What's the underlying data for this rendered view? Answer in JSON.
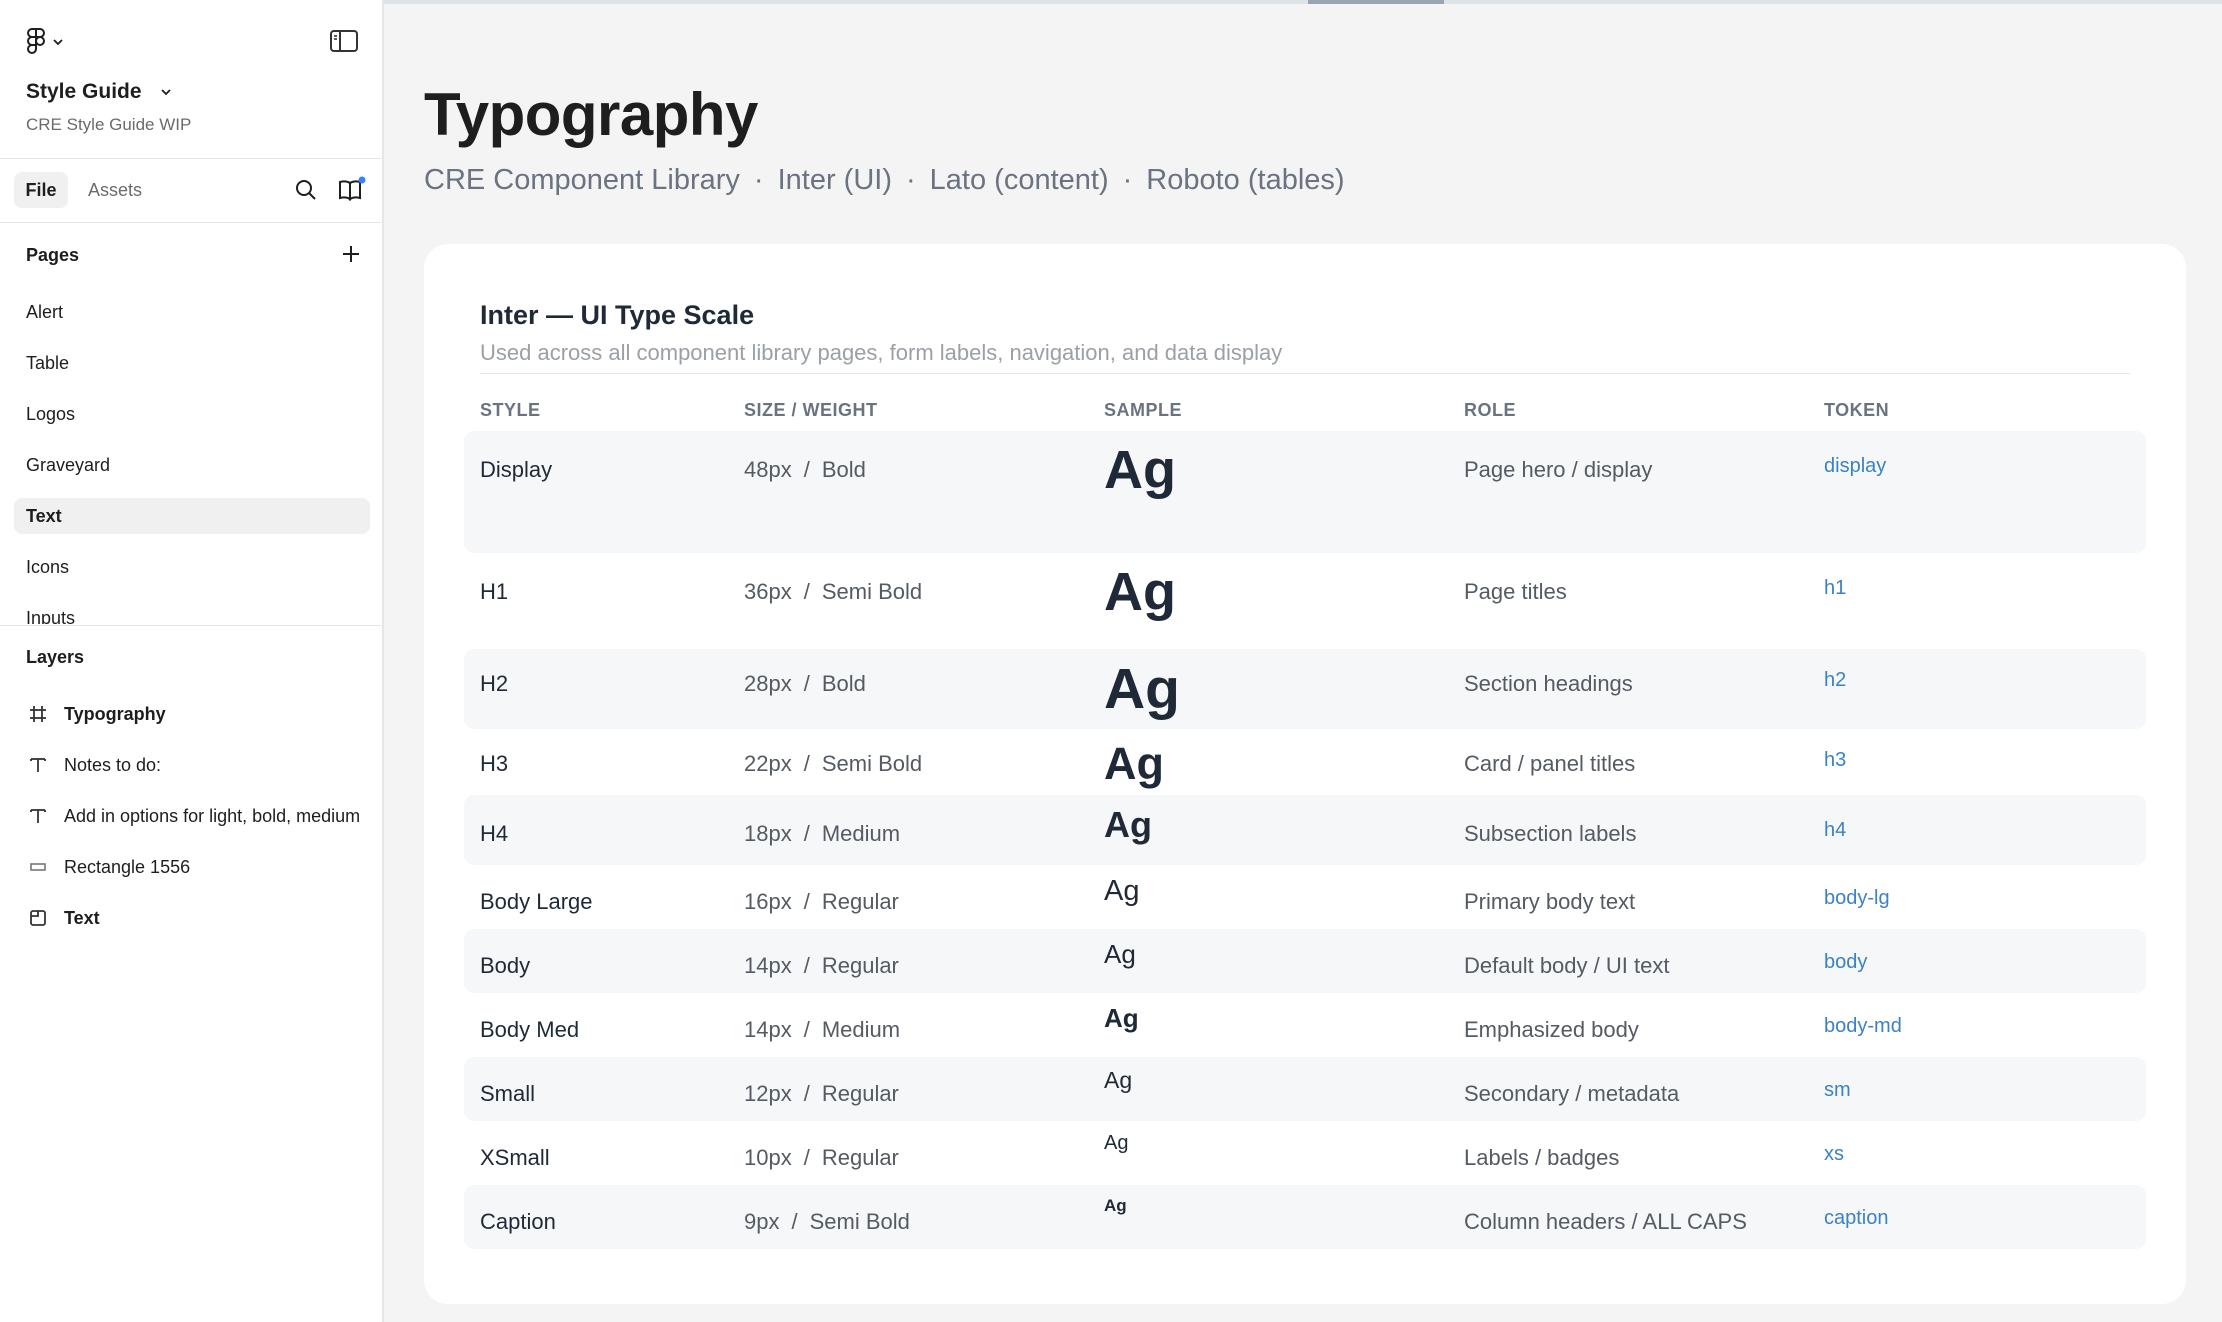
{
  "sidebar": {
    "file_title": "Style Guide",
    "file_subtitle": "CRE Style Guide WIP",
    "tabs": {
      "file": "File",
      "assets": "Assets"
    },
    "pages_title": "Pages",
    "pages": [
      {
        "label": "Alert",
        "active": false
      },
      {
        "label": "Table",
        "active": false
      },
      {
        "label": "Logos",
        "active": false
      },
      {
        "label": "Graveyard",
        "active": false
      },
      {
        "label": "Text",
        "active": true
      },
      {
        "label": "Icons",
        "active": false
      },
      {
        "label": "Inputs",
        "active": false
      }
    ],
    "layers_title": "Layers",
    "layers": [
      {
        "label": "Typography",
        "icon": "frame-icon",
        "bold": true
      },
      {
        "label": "Notes to do:",
        "icon": "text-icon",
        "bold": false
      },
      {
        "label": "Add in options for light, bold, medium",
        "icon": "text-icon",
        "bold": false
      },
      {
        "label": "Rectangle 1556",
        "icon": "rectangle-icon",
        "bold": false
      },
      {
        "label": "Text",
        "icon": "section-icon",
        "bold": true
      }
    ]
  },
  "canvas": {
    "title": "Typography",
    "subtitle_parts": [
      "CRE Component Library",
      "Inter (UI)",
      "Lato (content)",
      "Roboto (tables)"
    ],
    "subtitle_separator": "·",
    "card": {
      "title": "Inter — UI Type Scale",
      "description": "Used across all component library pages, form labels, navigation, and data display",
      "columns": {
        "style": "STYLE",
        "size": "SIZE / WEIGHT",
        "sample": "SAMPLE",
        "role": "ROLE",
        "token": "TOKEN"
      },
      "size_separator": "/",
      "sample_text": "Ag",
      "rows": [
        {
          "style": "Display",
          "size": "48px",
          "weight": "Bold",
          "role": "Page hero / display",
          "token": "display"
        },
        {
          "style": "H1",
          "size": "36px",
          "weight": "Semi Bold",
          "role": "Page titles",
          "token": "h1"
        },
        {
          "style": "H2",
          "size": "28px",
          "weight": "Bold",
          "role": "Section headings",
          "token": "h2"
        },
        {
          "style": "H3",
          "size": "22px",
          "weight": "Semi Bold",
          "role": "Card / panel titles",
          "token": "h3"
        },
        {
          "style": "H4",
          "size": "18px",
          "weight": "Medium",
          "role": "Subsection labels",
          "token": "h4"
        },
        {
          "style": "Body Large",
          "size": "16px",
          "weight": "Regular",
          "role": "Primary body text",
          "token": "body-lg"
        },
        {
          "style": "Body",
          "size": "14px",
          "weight": "Regular",
          "role": "Default body / UI text",
          "token": "body"
        },
        {
          "style": "Body Med",
          "size": "14px",
          "weight": "Medium",
          "role": "Emphasized body",
          "token": "body-md"
        },
        {
          "style": "Small",
          "size": "12px",
          "weight": "Regular",
          "role": "Secondary / metadata",
          "token": "sm"
        },
        {
          "style": "XSmall",
          "size": "10px",
          "weight": "Regular",
          "role": "Labels / badges",
          "token": "xs"
        },
        {
          "style": "Caption",
          "size": "9px",
          "weight": "Semi Bold",
          "role": "Column headers / ALL CAPS",
          "token": "caption"
        }
      ]
    }
  },
  "colors": {
    "accent": "#3b82c4",
    "notification_dot": "#3b82f6",
    "canvas_bg": "#f4f4f5",
    "card_bg": "#ffffff"
  }
}
